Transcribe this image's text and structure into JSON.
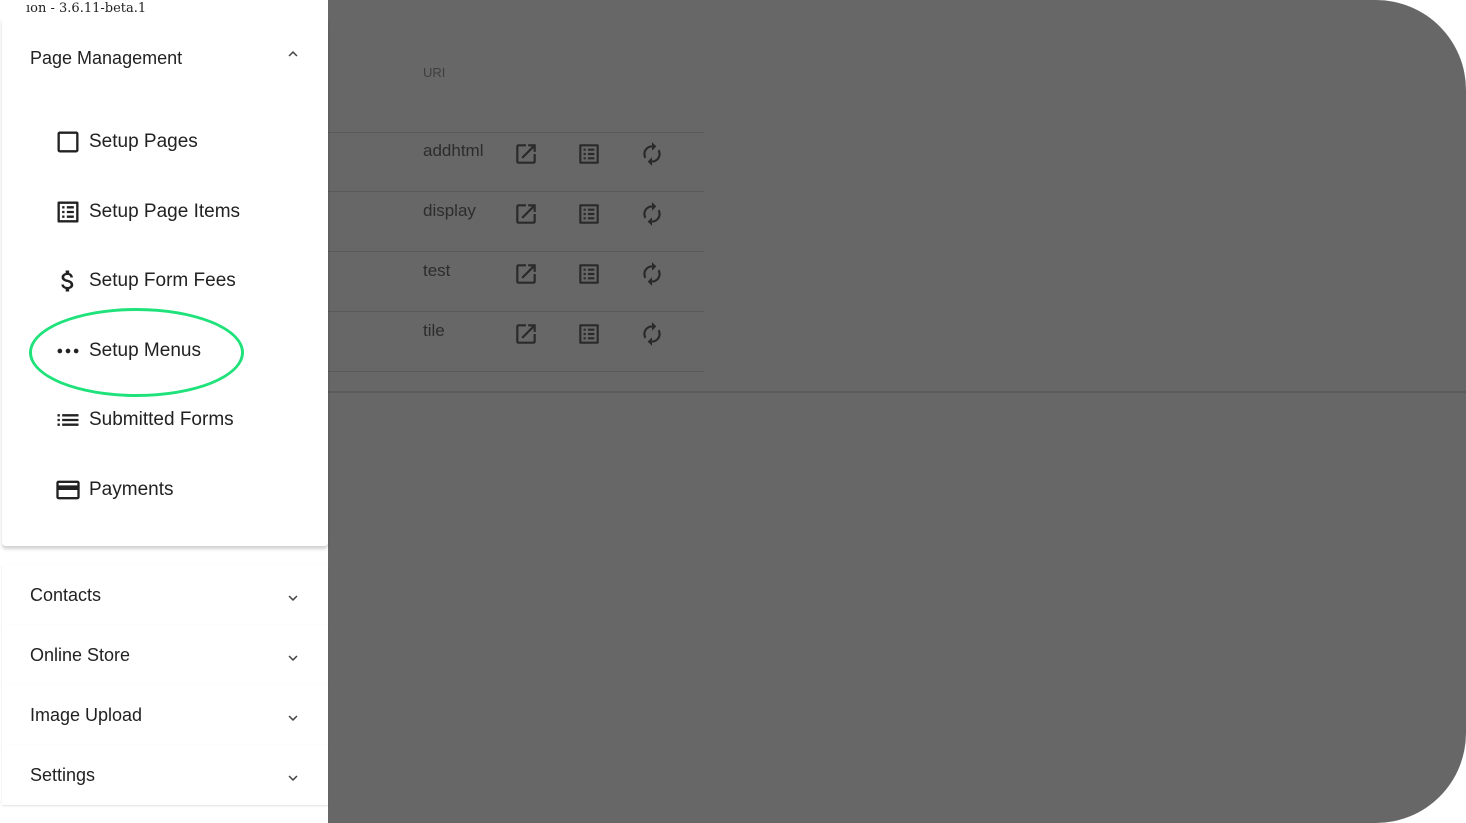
{
  "version_text": "ıon - 3.6.11-beta.1",
  "page_management": {
    "title": "Page Management",
    "items": [
      {
        "label": "Setup Pages",
        "icon": "checkbox-outline-icon"
      },
      {
        "label": "Setup Page Items",
        "icon": "list-box-icon"
      },
      {
        "label": "Setup Form Fees",
        "icon": "dollar-icon"
      },
      {
        "label": "Setup Menus",
        "icon": "dots-horizontal-icon"
      },
      {
        "label": "Submitted Forms",
        "icon": "format-list-icon"
      },
      {
        "label": "Payments",
        "icon": "credit-card-icon"
      }
    ]
  },
  "collapsed_sections": [
    {
      "label": "Contacts"
    },
    {
      "label": "Online Store"
    },
    {
      "label": "Image Upload"
    },
    {
      "label": "Settings"
    }
  ],
  "table": {
    "uri_header": "URI",
    "rows": [
      {
        "uri": "addhtml"
      },
      {
        "uri": "display"
      },
      {
        "uri": "test"
      },
      {
        "uri": "tile"
      }
    ]
  },
  "colors": {
    "highlight": "#1fe27a",
    "overlay": "#676767"
  }
}
